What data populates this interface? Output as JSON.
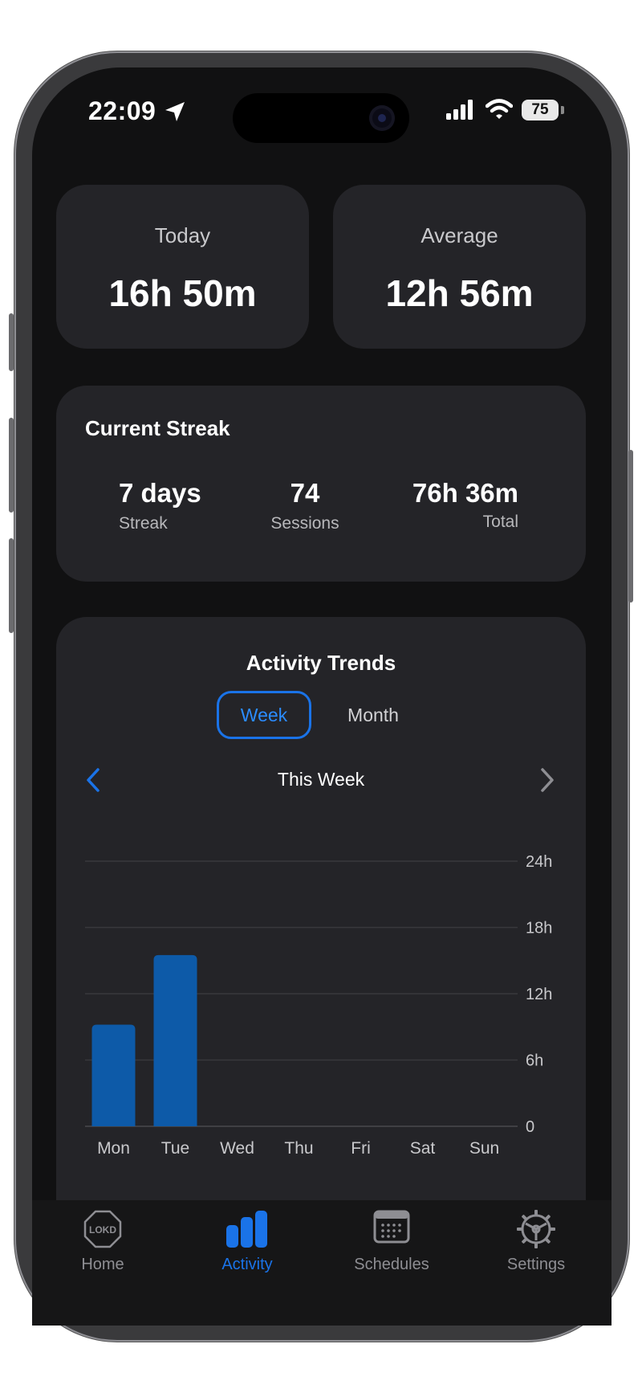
{
  "status_bar": {
    "time": "22:09",
    "battery": "75"
  },
  "today_card": {
    "label": "Today",
    "value": "16h 50m"
  },
  "average_card": {
    "label": "Average",
    "value": "12h 56m"
  },
  "streak_card": {
    "title": "Current Streak",
    "stats": [
      {
        "value": "7 days",
        "label": "Streak"
      },
      {
        "value": "74",
        "label": "Sessions"
      },
      {
        "value": "76h 36m",
        "label": "Total"
      }
    ]
  },
  "trends": {
    "title": "Activity Trends",
    "segments": {
      "week": "Week",
      "month": "Month",
      "selected": "Week"
    },
    "period_label": "This Week"
  },
  "chart_data": {
    "type": "bar",
    "categories": [
      "Mon",
      "Tue",
      "Wed",
      "Thu",
      "Fri",
      "Sat",
      "Sun"
    ],
    "values": [
      9.2,
      15.5,
      0,
      0,
      0,
      0,
      0
    ],
    "yticks": [
      "0",
      "6h",
      "12h",
      "18h",
      "24h"
    ],
    "ylim": [
      0,
      24
    ],
    "grid": true,
    "bar_color": "#0d5aa8"
  },
  "tabbar": {
    "items": [
      {
        "label": "Home",
        "icon": "home-logo-icon",
        "active": false
      },
      {
        "label": "Activity",
        "icon": "bar-chart-icon",
        "active": true
      },
      {
        "label": "Schedules",
        "icon": "calendar-icon",
        "active": false
      },
      {
        "label": "Settings",
        "icon": "gear-icon",
        "active": false
      }
    ],
    "active_color": "#1a73e8",
    "inactive_color": "#8e8e93"
  }
}
